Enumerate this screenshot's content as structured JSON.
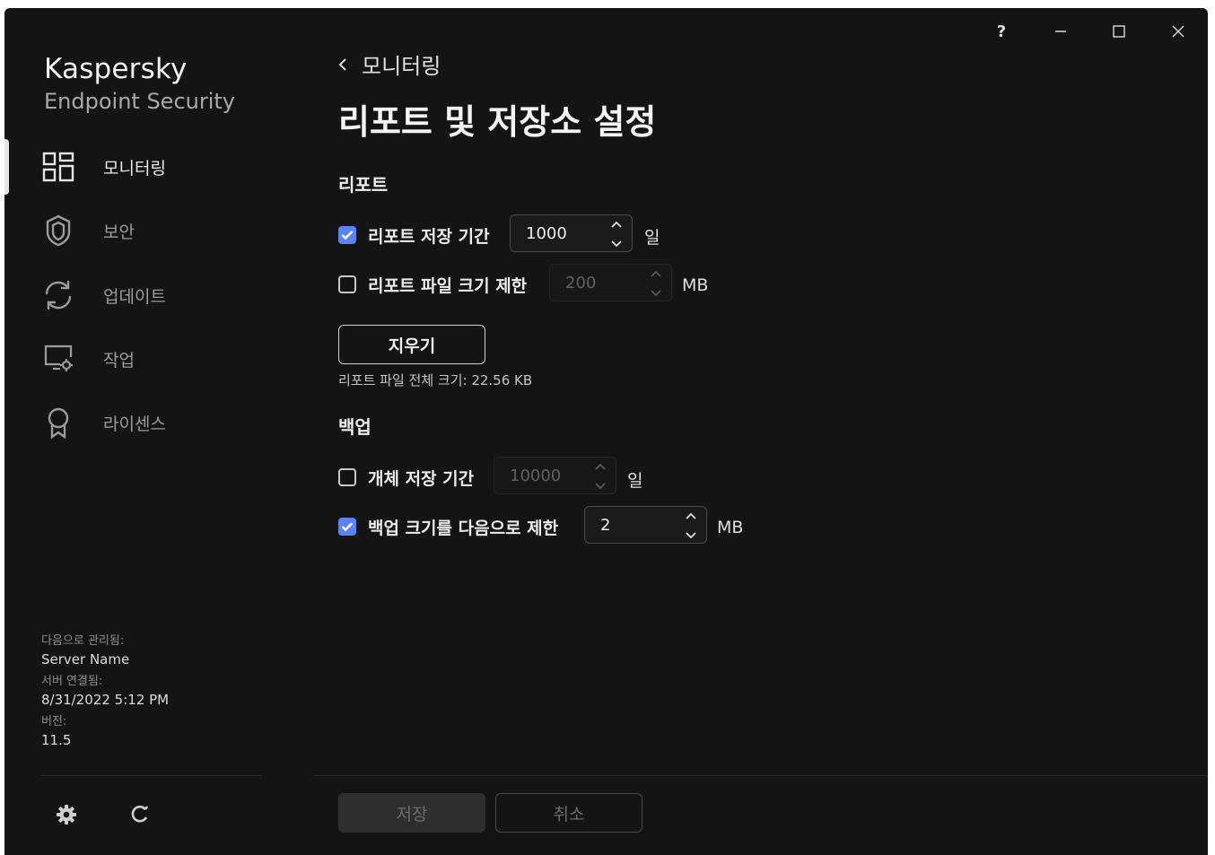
{
  "window_controls": {
    "help": "?"
  },
  "sidebar": {
    "brand_name": "Kaspersky",
    "brand_sub": "Endpoint Security",
    "items": [
      {
        "label": "모니터링",
        "icon": "monitoring-icon",
        "active": true
      },
      {
        "label": "보안",
        "icon": "shield-icon",
        "active": false
      },
      {
        "label": "업데이트",
        "icon": "refresh-icon",
        "active": false
      },
      {
        "label": "작업",
        "icon": "task-monitor-icon",
        "active": false
      },
      {
        "label": "라이센스",
        "icon": "license-icon",
        "active": false
      }
    ],
    "managed_by_label": "다음으로 관리됨:",
    "managed_by_value": "Server Name",
    "server_connected_label": "서버 연결됨:",
    "server_connected_value": "8/31/2022 5:12 PM",
    "version_label": "버전:",
    "version_value": "11.5"
  },
  "main": {
    "back_label": "모니터링",
    "page_title": "리포트 및 저장소 설정",
    "reports": {
      "section_title": "리포트",
      "retention": {
        "label": "리포트 저장 기간",
        "checked": true,
        "value": "1000",
        "unit": "일"
      },
      "file_size_limit": {
        "label": "리포트 파일 크기 제한",
        "checked": false,
        "value": "200",
        "unit": "MB"
      },
      "clear_button": "지우기",
      "total_size": "리포트 파일 전체 크기: 22.56 KB"
    },
    "backup": {
      "section_title": "백업",
      "retention": {
        "label": "개체 저장 기간",
        "checked": false,
        "value": "10000",
        "unit": "일"
      },
      "size_limit": {
        "label": "백업 크기를 다음으로 제한",
        "checked": true,
        "value": "2",
        "unit": "MB"
      }
    },
    "footer": {
      "save": "저장",
      "cancel": "취소"
    }
  },
  "colors": {
    "accent": "#5b82ff",
    "background": "#141414"
  }
}
